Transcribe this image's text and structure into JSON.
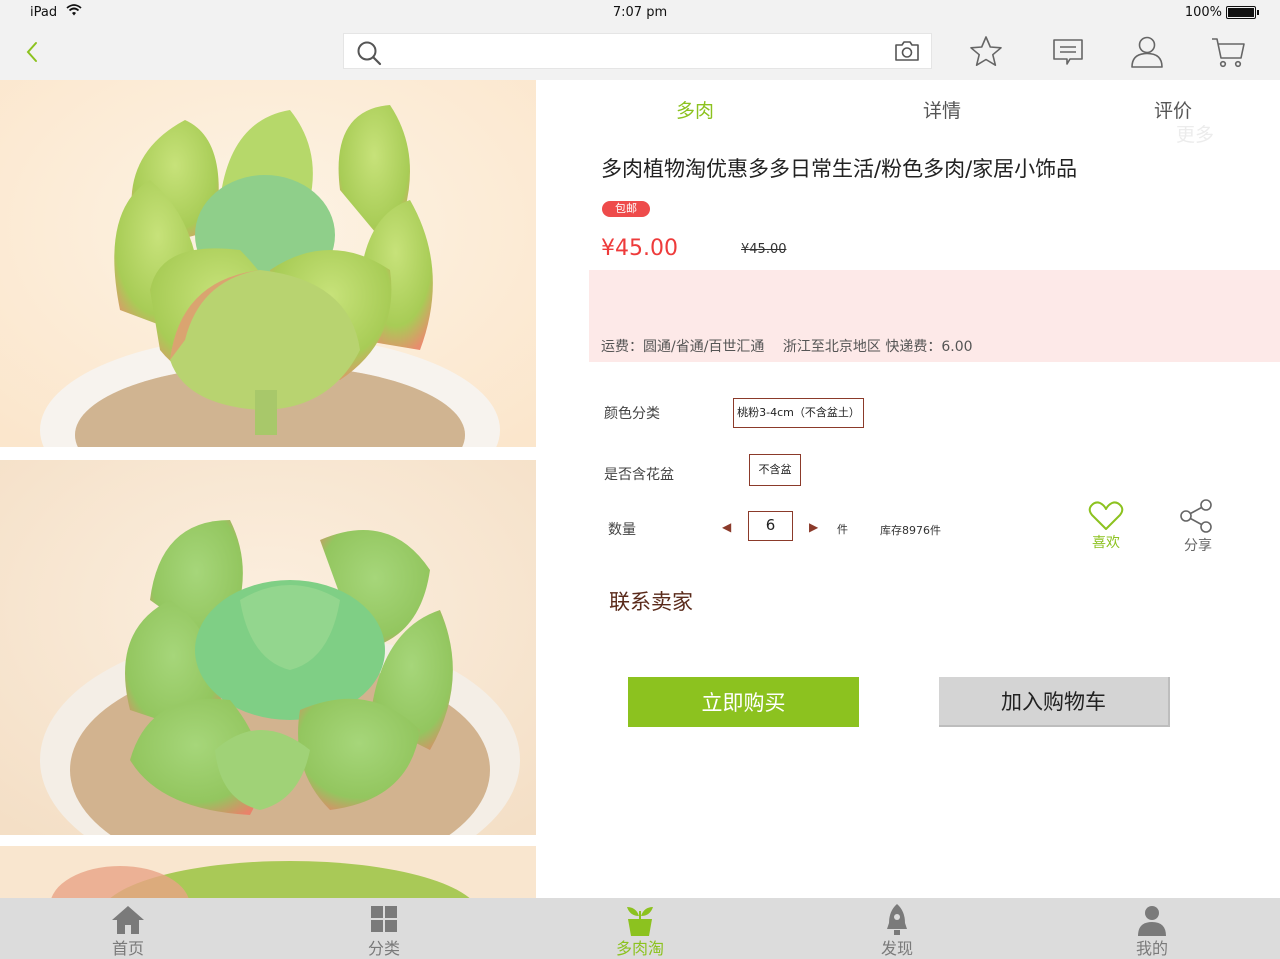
{
  "status_bar": {
    "carrier": "iPad",
    "time": "7:07 pm",
    "battery": "100%"
  },
  "nav": {
    "search_placeholder": "",
    "icons": [
      "back-chevron-icon",
      "search-icon",
      "camera-icon",
      "star-icon",
      "message-icon",
      "user-icon",
      "cart-icon"
    ]
  },
  "tabs": [
    {
      "label": "多肉",
      "active": true
    },
    {
      "label": "详情",
      "active": false
    },
    {
      "label": "评价",
      "active": false
    }
  ],
  "tab_more": "更多",
  "product": {
    "title": "多肉植物淘优惠多多日常生活/粉色多肉/家居小饰品",
    "badge": "包邮",
    "price": "¥45.00",
    "old_price": "¥45.00",
    "shipping": "运费：圆通/省通/百世汇通　 浙江至北京地区 快递费：6.00"
  },
  "options": {
    "color_label": "颜色分类",
    "color_value": "桃粉3-4cm（不含盆土）",
    "pot_label": "是否含花盆",
    "pot_value": "不含盆",
    "qty_label": "数量",
    "qty_value": "6",
    "qty_unit": "件",
    "stock": "库存8976件"
  },
  "actions": {
    "like": "喜欢",
    "share": "分享",
    "contact": "联系卖家",
    "buy_now": "立即购买",
    "add_cart": "加入购物车"
  },
  "bottom_tabs": [
    {
      "label": "首页",
      "icon": "home-icon",
      "active": false
    },
    {
      "label": "分类",
      "icon": "grid-icon",
      "active": false
    },
    {
      "label": "多肉淘",
      "icon": "plant-pot-icon",
      "active": true
    },
    {
      "label": "发现",
      "icon": "rocket-icon",
      "active": false
    },
    {
      "label": "我的",
      "icon": "person-icon",
      "active": false
    }
  ],
  "colors": {
    "accent": "#8cc21f",
    "price": "#ee3b3b",
    "panel": "#fde9e8",
    "option_border": "#8b3a2a"
  }
}
